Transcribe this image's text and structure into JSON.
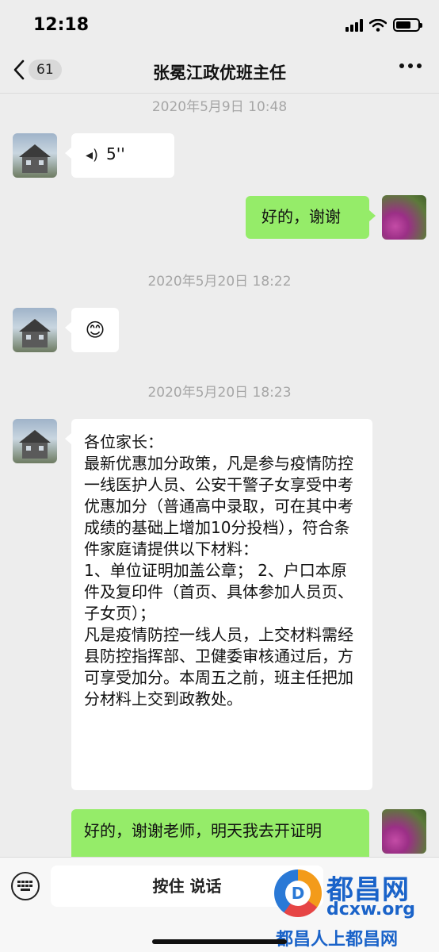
{
  "status_bar": {
    "time": "12:18"
  },
  "nav": {
    "back_badge": "61",
    "title": "张冕江政优班主任"
  },
  "timestamps": [
    "2020年5月9日 10:48",
    "2020年5月20日 18:22",
    "2020年5月20日 18:23"
  ],
  "messages": {
    "voice_duration": "5''",
    "reply_1": "好的，谢谢",
    "emoji": "😊",
    "notice": "各位家长：\n最新优惠加分政策，凡是参与疫情防控一线医护人员、公安干警子女享受中考优惠加分（普通高中录取，可在其中考成绩的基础上增加10分投档），符合条件家庭请提供以下材料：\n1、单位证明加盖公章； 2、户口本原件及复印件（首页、具体参加人员页、子女页）；\n凡是疫情防控一线人员，上交材料需经县防控指挥部、卫健委审核通过后，方可享受加分。本周五之前，班主任把加分材料上交到政教处。",
    "reply_2": "好的，谢谢老师，明天我去开证明"
  },
  "input_bar": {
    "hold_to_talk": "按住 说话"
  },
  "watermark": {
    "name": "都昌网",
    "url": "dcxw.org",
    "slogan": "都昌人上都昌网",
    "logo_letter": "D"
  },
  "colors": {
    "background": "#ededed",
    "sent_bubble": "#95ec69",
    "received_bubble": "#ffffff",
    "watermark": "#1a63c9"
  }
}
